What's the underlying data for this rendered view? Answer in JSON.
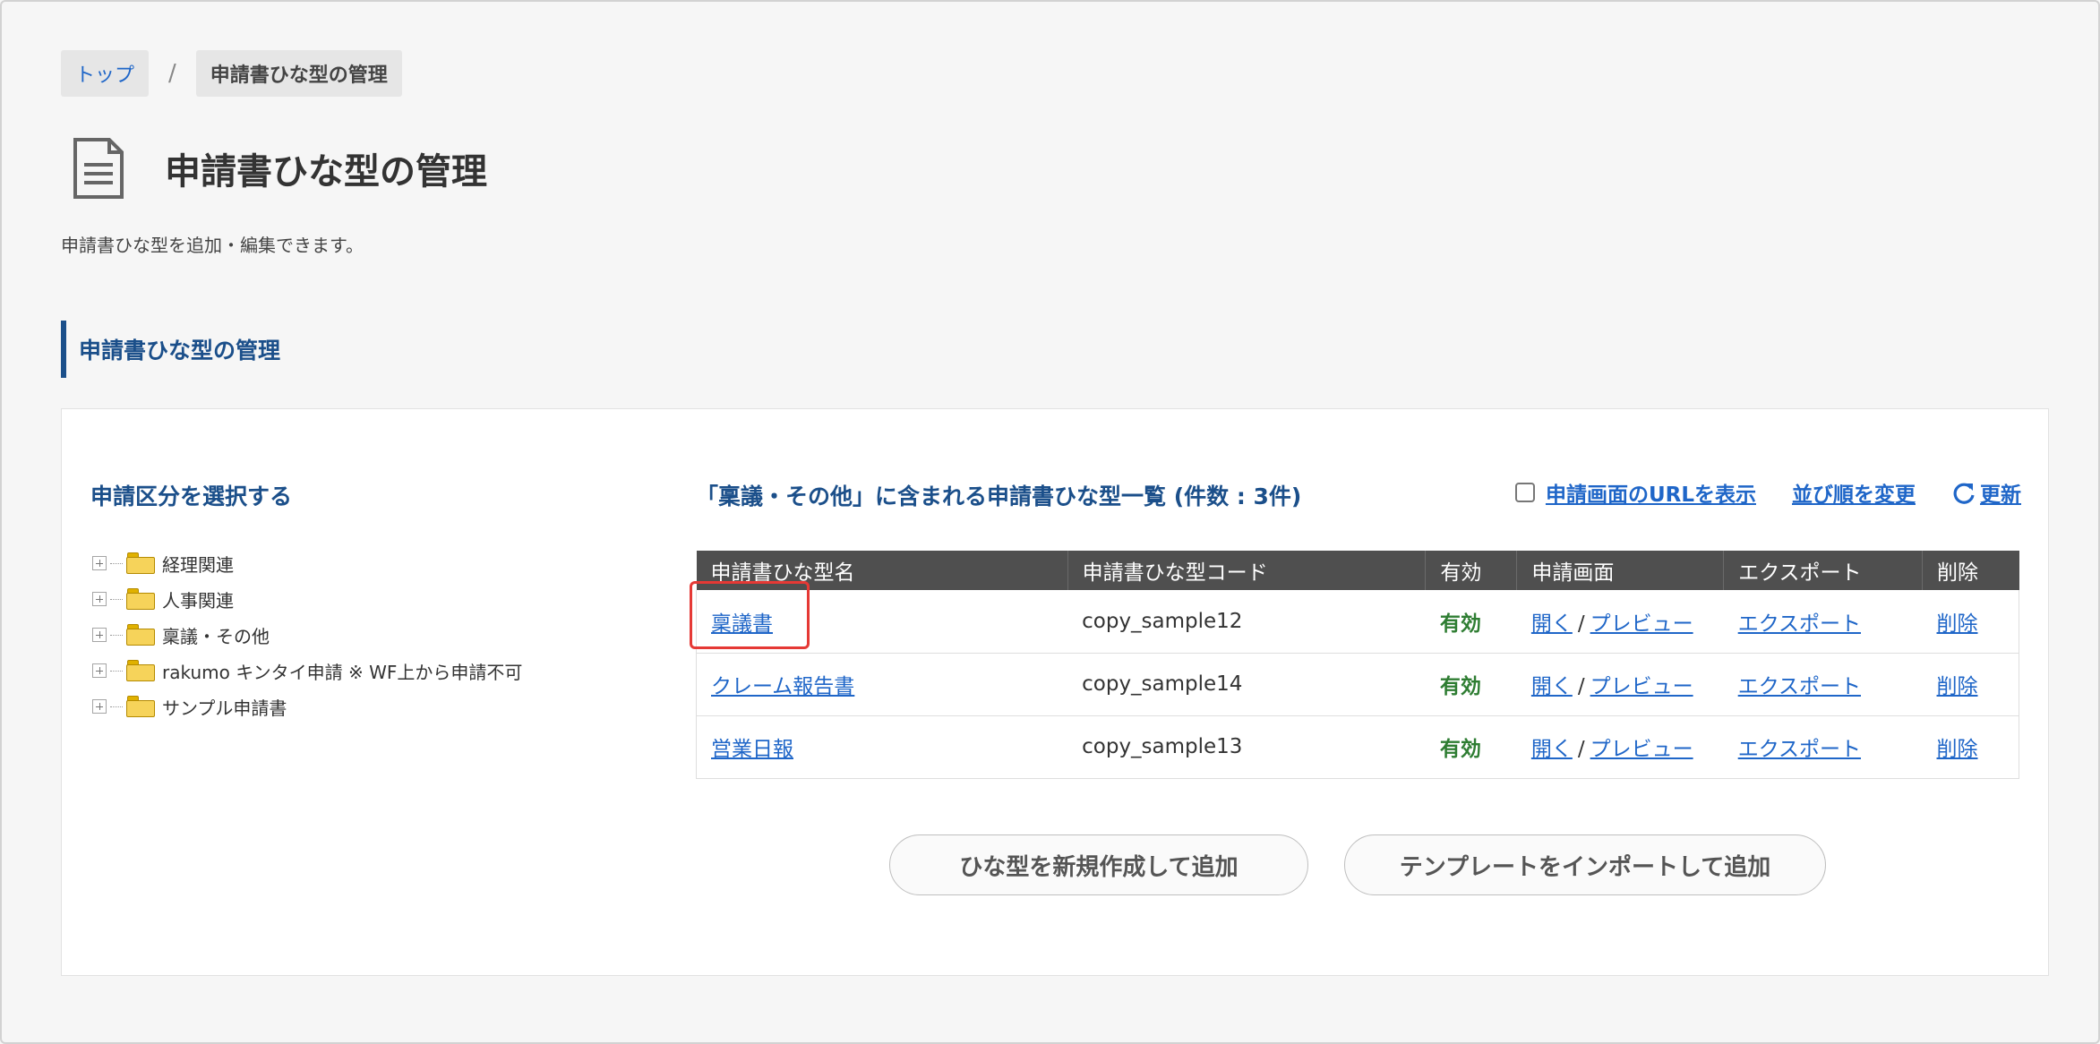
{
  "breadcrumb": {
    "home": "トップ",
    "separator": "/",
    "current": "申請書ひな型の管理"
  },
  "header": {
    "title": "申請書ひな型の管理",
    "description": "申請書ひな型を追加・編集できます。",
    "icon": "document-icon"
  },
  "section": {
    "title": "申請書ひな型の管理"
  },
  "tree": {
    "title": "申請区分を選択する",
    "items": [
      {
        "label": "経理関連"
      },
      {
        "label": "人事関連"
      },
      {
        "label": "稟議・その他"
      },
      {
        "label": "rakumo キンタイ申請 ※ WF上から申請不可"
      },
      {
        "label": "サンプル申請書"
      }
    ]
  },
  "list": {
    "title": "「稟議・その他」に含まれる申請書ひな型一覧 (件数 : 3件)",
    "show_url_label": "申請画面のURLを表示",
    "show_url_checked": false,
    "reorder_label": "並び順を変更",
    "refresh_label": "更新",
    "columns": [
      "申請書ひな型名",
      "申請書ひな型コード",
      "有効",
      "申請画面",
      "エクスポート",
      "削除"
    ],
    "rows": [
      {
        "name": "稟議書",
        "code": "copy_sample12",
        "status": "有効",
        "open": "開く",
        "sep": "/",
        "preview": "プレビュー",
        "export": "エクスポート",
        "delete": "削除"
      },
      {
        "name": "クレーム報告書",
        "code": "copy_sample14",
        "status": "有効",
        "open": "開く",
        "sep": "/",
        "preview": "プレビュー",
        "export": "エクスポート",
        "delete": "削除"
      },
      {
        "name": "営業日報",
        "code": "copy_sample13",
        "status": "有効",
        "open": "開く",
        "sep": "/",
        "preview": "プレビュー",
        "export": "エクスポート",
        "delete": "削除"
      }
    ]
  },
  "actions": {
    "new_template": "ひな型を新規作成して追加",
    "import_template": "テンプレートをインポートして追加"
  },
  "colors": {
    "accent": "#1b4f8a",
    "link": "#1f66c8",
    "valid": "#2e7d32",
    "highlight": "#e53935"
  }
}
